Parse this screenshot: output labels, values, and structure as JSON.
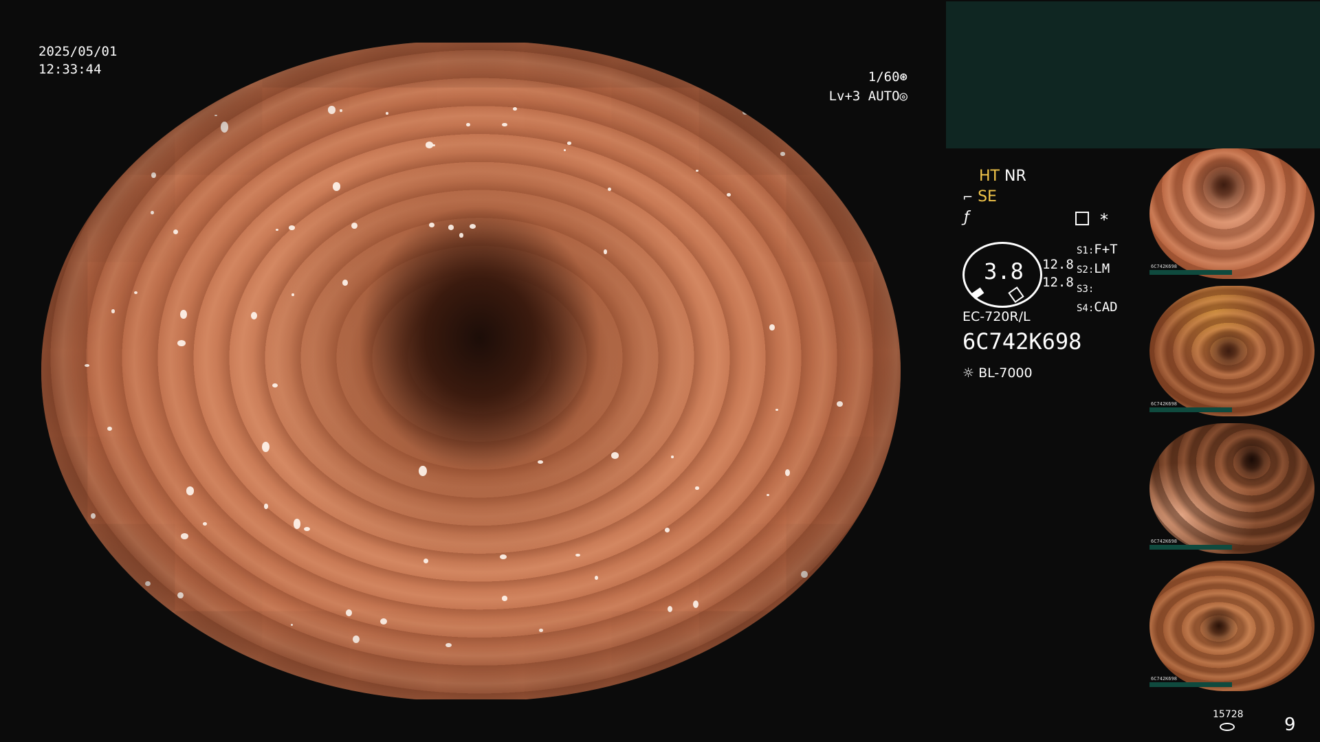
{
  "datetime": {
    "date": "2025/05/01",
    "time": "12:33:44"
  },
  "overlay": {
    "shutter": "1/60",
    "level": "Lv+3",
    "mode": "AUTO"
  },
  "settings": {
    "ht": "HT",
    "nr": "NR",
    "se": "SE",
    "zoom_value": "3.8",
    "value_a": "12.8",
    "value_b": "12.8",
    "star": "*"
  },
  "switches": [
    {
      "key": "S1:",
      "value": "F+T"
    },
    {
      "key": "S2:",
      "value": "LM"
    },
    {
      "key": "S3:",
      "value": ""
    },
    {
      "key": "S4:",
      "value": "CAD"
    }
  ],
  "scope": {
    "model": "EC-720R/L",
    "serial": "6C742K698",
    "light_source": "BL-7000"
  },
  "footer": {
    "storage_count": "15728",
    "image_count": "9"
  },
  "thumbnails": [
    {
      "name": "capture-1",
      "serial": "6C742K698"
    },
    {
      "name": "capture-2",
      "serial": "6C742K698"
    },
    {
      "name": "capture-3",
      "serial": "6C742K698"
    },
    {
      "name": "capture-4",
      "serial": "6C742K698"
    }
  ],
  "colors": {
    "accent_yellow": "#f3c64a",
    "panel_teal": "#0f2622",
    "thumb_bar": "#0f4a3e"
  },
  "icons": [
    "aperture-icon",
    "auto-exposure-icon",
    "scope-tip-icon",
    "freeze-icon",
    "memory-icon",
    "light-source-icon",
    "storage-icon"
  ]
}
